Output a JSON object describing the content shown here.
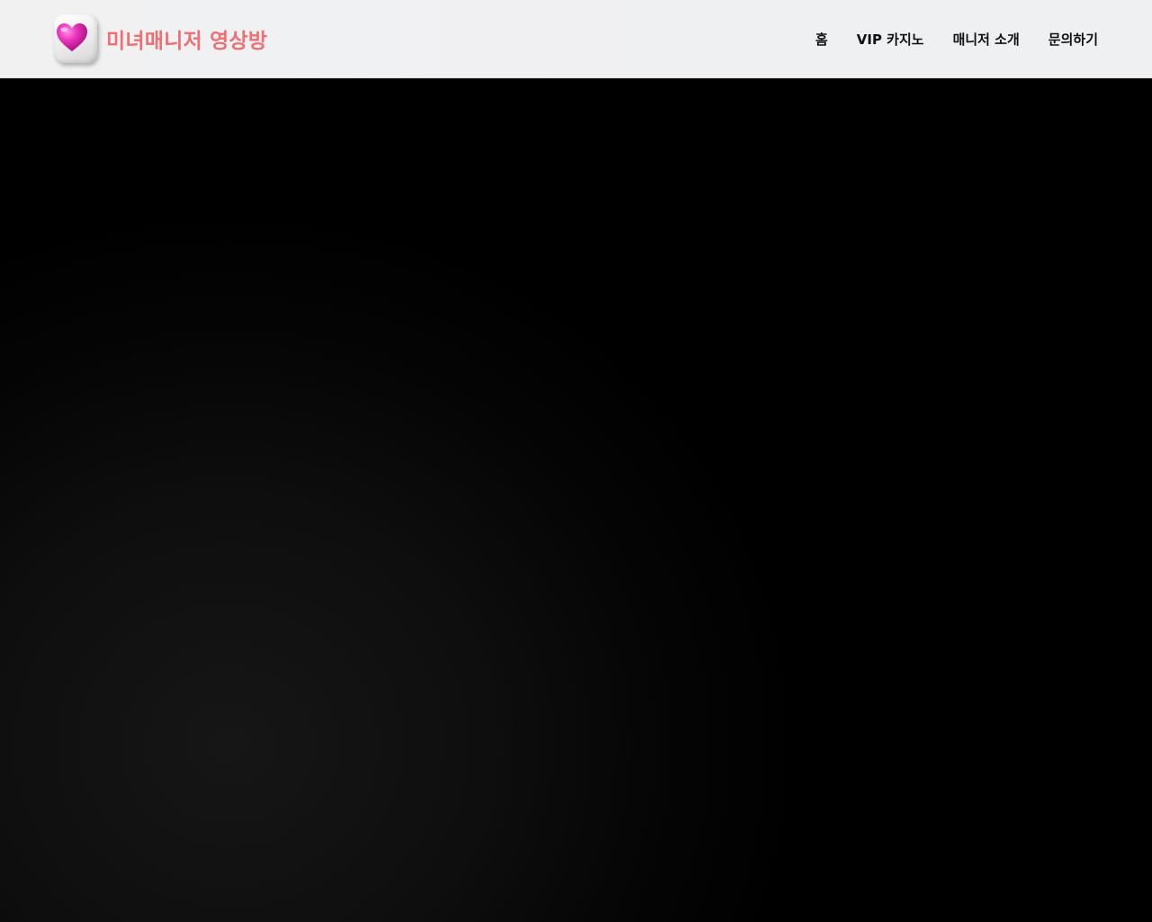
{
  "header": {
    "brand": {
      "title": "미녀매니저 영상방",
      "logo_icon": "heart-icon",
      "title_color": "#f06f72"
    },
    "nav": {
      "items": [
        {
          "label": "홈"
        },
        {
          "label": "VIP 카지노"
        },
        {
          "label": "매니저 소개"
        },
        {
          "label": "문의하기"
        }
      ]
    }
  },
  "hero": {
    "background_color": "#000000"
  }
}
